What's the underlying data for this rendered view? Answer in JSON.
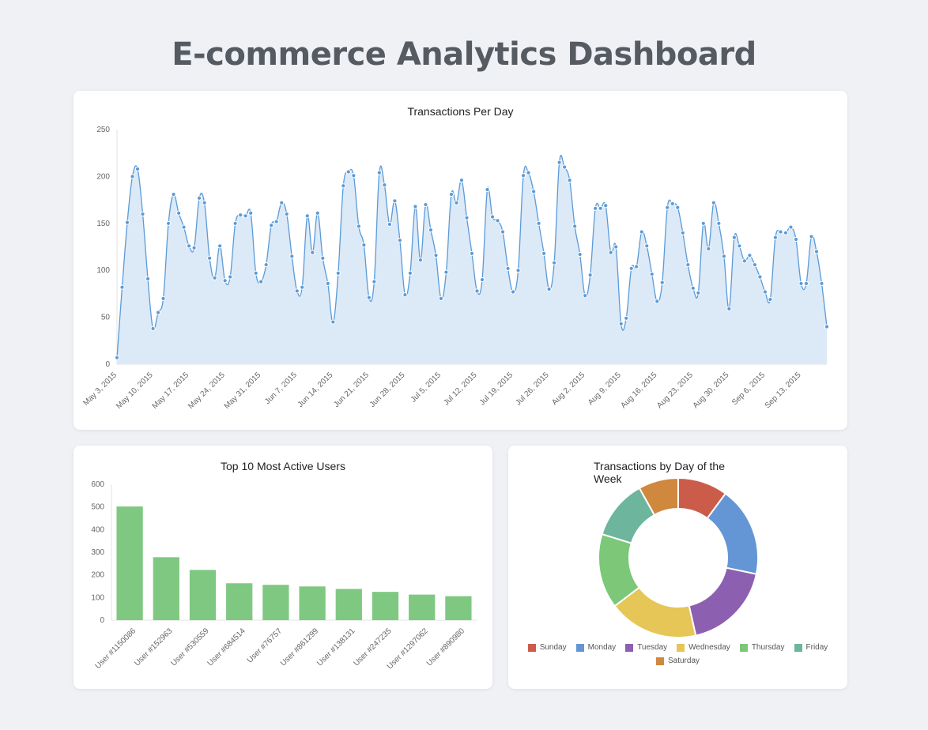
{
  "header": {
    "title": "E-commerce Analytics Dashboard"
  },
  "chart_data": [
    {
      "type": "area",
      "title": "Transactions Per Day",
      "ylim": [
        0,
        250
      ],
      "yticks": [
        0,
        50,
        100,
        150,
        200,
        250
      ],
      "xticks": [
        "May 3, 2015",
        "May 10, 2015",
        "May 17, 2015",
        "May 24, 2015",
        "May 31, 2015",
        "Jun 7, 2015",
        "Jun 14, 2015",
        "Jun 21, 2015",
        "Jun 28, 2015",
        "Jul 5, 2015",
        "Jul 12, 2015",
        "Jul 19, 2015",
        "Jul 26, 2015",
        "Aug 2, 2015",
        "Aug 9, 2015",
        "Aug 16, 2015",
        "Aug 23, 2015",
        "Aug 30, 2015",
        "Sep 6, 2015",
        "Sep 13, 2015"
      ],
      "values": [
        7,
        82,
        151,
        200,
        208,
        160,
        91,
        38,
        55,
        70,
        150,
        181,
        161,
        146,
        126,
        124,
        177,
        172,
        113,
        92,
        126,
        89,
        93,
        150,
        159,
        158,
        161,
        97,
        88,
        106,
        148,
        152,
        172,
        160,
        115,
        78,
        82,
        158,
        119,
        161,
        113,
        86,
        45,
        97,
        190,
        205,
        201,
        147,
        127,
        71,
        88,
        204,
        191,
        149,
        174,
        132,
        74,
        97,
        168,
        111,
        170,
        143,
        116,
        70,
        98,
        181,
        172,
        196,
        156,
        118,
        78,
        90,
        186,
        157,
        153,
        141,
        102,
        77,
        100,
        201,
        204,
        184,
        150,
        118,
        80,
        108,
        215,
        210,
        196,
        147,
        117,
        73,
        95,
        166,
        166,
        169,
        119,
        125,
        43,
        49,
        102,
        104,
        141,
        126,
        96,
        67,
        87,
        167,
        171,
        167,
        140,
        106,
        81,
        76,
        150,
        123,
        172,
        150,
        115,
        59,
        135,
        126,
        110,
        116,
        106,
        93,
        77,
        69,
        135,
        141,
        140,
        146,
        133,
        86,
        86,
        136,
        120,
        86,
        40
      ],
      "color": "#5a9bd8",
      "fill": "#dce9f7"
    },
    {
      "type": "bar",
      "title": "Top 10 Most Active Users",
      "ylim": [
        0,
        600
      ],
      "yticks": [
        0,
        100,
        200,
        300,
        400,
        500,
        600
      ],
      "categories": [
        "User #1150086",
        "User #152963",
        "User #530559",
        "User #684514",
        "User #76757",
        "User #861299",
        "User #138131",
        "User #247235",
        "User #1297062",
        "User #890980"
      ],
      "values": [
        502,
        278,
        222,
        163,
        156,
        149,
        138,
        125,
        113,
        106
      ],
      "color": "#7fc881"
    },
    {
      "type": "pie",
      "title": "Transactions by Day of the Week",
      "donut": true,
      "categories": [
        "Sunday",
        "Monday",
        "Tuesday",
        "Wednesday",
        "Thursday",
        "Friday",
        "Saturday"
      ],
      "values": [
        10,
        18,
        18,
        18,
        15,
        12,
        8
      ],
      "colors": [
        "#cb5c4a",
        "#6496d6",
        "#8d5fb1",
        "#e6c656",
        "#7cc778",
        "#6db59c",
        "#d0883f"
      ],
      "legend_position": "bottom"
    }
  ]
}
